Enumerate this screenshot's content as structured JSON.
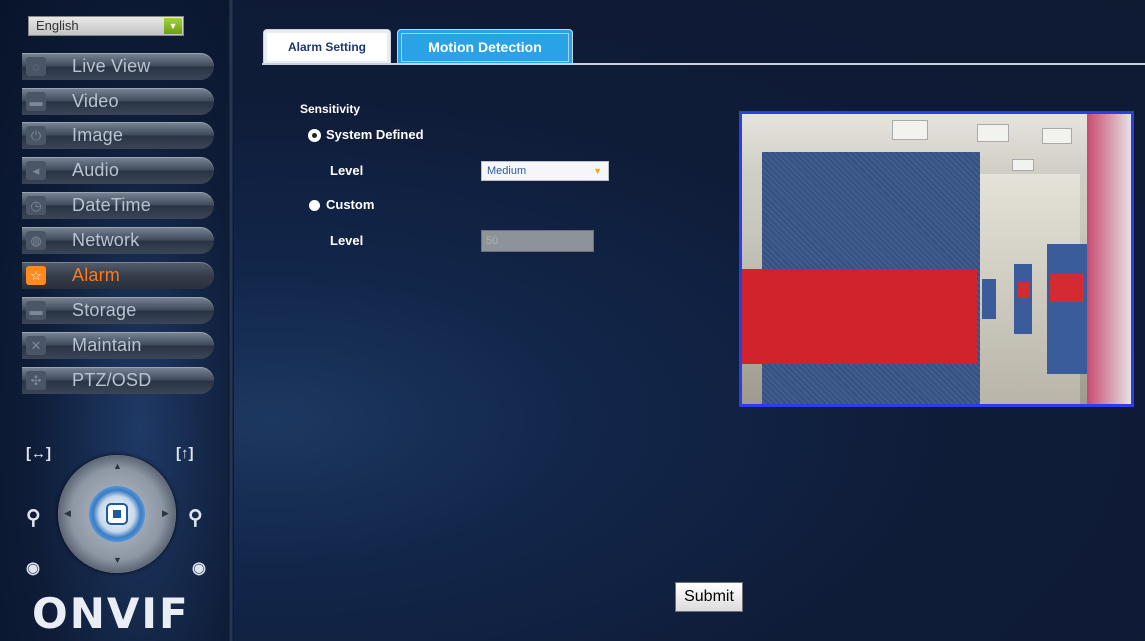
{
  "language": {
    "selected": "English"
  },
  "menu": {
    "items": [
      {
        "label": "Live View",
        "icon": "chat-bubble-icon"
      },
      {
        "label": "Video",
        "icon": "camera-icon"
      },
      {
        "label": "Image",
        "icon": "power-icon"
      },
      {
        "label": "Audio",
        "icon": "speaker-icon"
      },
      {
        "label": "DateTime",
        "icon": "clock-icon"
      },
      {
        "label": "Network",
        "icon": "globe-icon"
      },
      {
        "label": "Alarm",
        "icon": "star-icon",
        "active": true
      },
      {
        "label": "Storage",
        "icon": "drive-icon"
      },
      {
        "label": "Maintain",
        "icon": "wrench-icon"
      },
      {
        "label": "PTZ/OSD",
        "icon": "move-icon"
      }
    ]
  },
  "ptz": {
    "icons": [
      "zoom-fit-icon",
      "expand-icon",
      "zoom-out-icon",
      "zoom-in-icon",
      "focus-near-icon",
      "focus-far-icon",
      "stop-icon"
    ],
    "zoom_fit_glyph": "[↔]",
    "expand_glyph": "[↑]"
  },
  "logo": {
    "text": "ONVIF"
  },
  "tabs": [
    {
      "label": "Alarm Setting",
      "active": false
    },
    {
      "label": "Motion Detection",
      "active": true
    }
  ],
  "form": {
    "section_label": "Sensitivity",
    "system_defined": {
      "label": "System Defined",
      "checked": true
    },
    "system_level": {
      "label": "Level",
      "value": "Medium"
    },
    "custom": {
      "label": "Custom",
      "checked": false
    },
    "custom_level": {
      "label": "Level",
      "value": "50"
    }
  },
  "submit": {
    "label": "Submit"
  },
  "colors": {
    "accent": "#2aa3e6",
    "active_menu": "#ff7a1a",
    "preview_border": "#2b3fe8",
    "background": "#0f1b34"
  }
}
